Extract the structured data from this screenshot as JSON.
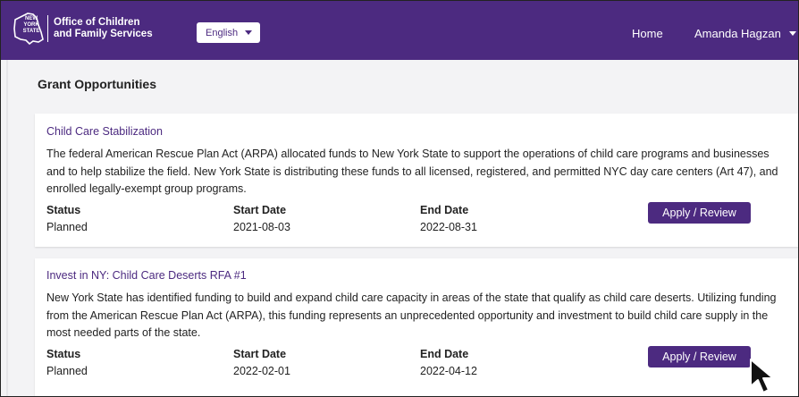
{
  "header": {
    "state_logo_text": [
      "NEW",
      "YORK",
      "STATE"
    ],
    "agency_line1": "Office of Children",
    "agency_line2": "and Family Services",
    "language": "English",
    "nav_home": "Home",
    "user_name": "Amanda Hagzan"
  },
  "page": {
    "title": "Grant Opportunities"
  },
  "labels": {
    "status": "Status",
    "start_date": "Start Date",
    "end_date": "End Date",
    "apply": "Apply / Review"
  },
  "grants": [
    {
      "title": "Child Care Stabilization",
      "description": "The federal American Rescue Plan Act (ARPA) allocated funds to New York State to support the operations of child care programs and businesses and to help stabilize the field. New York State is distributing these funds to all licensed, registered, and permitted NYC day care centers (Art 47), and enrolled legally-exempt group programs.",
      "status": "Planned",
      "start_date": "2021-08-03",
      "end_date": "2022-08-31"
    },
    {
      "title": "Invest in NY: Child Care Deserts RFA #1",
      "description": "New York State has identified funding to build and expand child care capacity in areas of the state that qualify as child care deserts. Utilizing funding from the American Rescue Plan Act (ARPA), this funding represents an unprecedented opportunity and investment to build child care supply in the most needed parts of the state.",
      "status": "Planned",
      "start_date": "2022-02-01",
      "end_date": "2022-04-12"
    }
  ],
  "colors": {
    "brand_purple": "#4c2a80",
    "background": "#f3f3f5"
  }
}
